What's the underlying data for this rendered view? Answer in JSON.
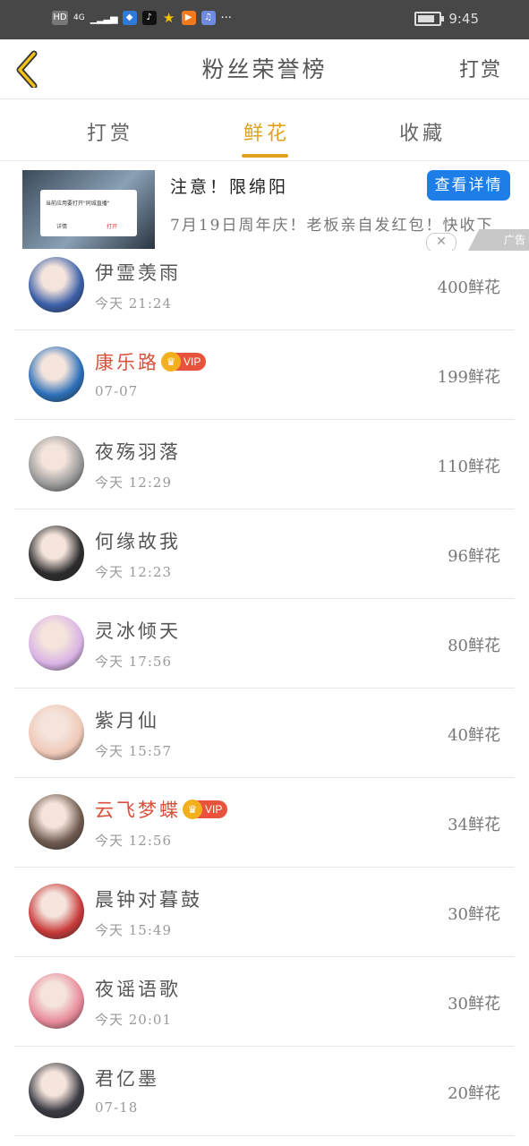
{
  "status_bar": {
    "hd": "HD",
    "network": "4G",
    "time": "9:45",
    "more": "···",
    "icons": [
      "shield-app-icon",
      "tiktok-icon",
      "star-app-icon",
      "video-app-icon",
      "music-app-icon"
    ]
  },
  "header": {
    "title": "粉丝荣誉榜",
    "action": "打赏"
  },
  "tabs": [
    {
      "label": "打赏",
      "active": false
    },
    {
      "label": "鲜花",
      "active": true
    },
    {
      "label": "收藏",
      "active": false
    }
  ],
  "ad": {
    "title": "注意！限绵阳",
    "description": "7月19日周年庆！老板亲自发红包！快收下",
    "button": "查看详情",
    "tag": "广告",
    "dialog_text": "当前应用要打开\"同城直播\"",
    "dialog_left": "详情",
    "dialog_right": "打开"
  },
  "vip_label": "VIP",
  "fans": [
    {
      "name": "伊霊羡雨",
      "time": "今天 21:24",
      "amount": "400鲜花",
      "vip": false,
      "avatar_color": "#3a5ea8"
    },
    {
      "name": "康乐路",
      "time": "07-07",
      "amount": "199鲜花",
      "vip": true,
      "avatar_color": "#2b6fb8"
    },
    {
      "name": "夜殇羽落",
      "time": "今天 12:29",
      "amount": "110鲜花",
      "vip": false,
      "avatar_color": "#9a9a9a"
    },
    {
      "name": "何缘故我",
      "time": "今天 12:23",
      "amount": "96鲜花",
      "vip": false,
      "avatar_color": "#2c2c2c"
    },
    {
      "name": "灵冰倾天",
      "time": "今天 17:56",
      "amount": "80鲜花",
      "vip": false,
      "avatar_color": "#d9b3e6"
    },
    {
      "name": "紫月仙",
      "time": "今天 15:57",
      "amount": "40鲜花",
      "vip": false,
      "avatar_color": "#f0c9b8"
    },
    {
      "name": "云飞梦蝶",
      "time": "今天 12:56",
      "amount": "34鲜花",
      "vip": true,
      "avatar_color": "#6e5a4e"
    },
    {
      "name": "晨钟对暮鼓",
      "time": "今天 15:49",
      "amount": "30鲜花",
      "vip": false,
      "avatar_color": "#c83a3a"
    },
    {
      "name": "夜谣语歌",
      "time": "今天 20:01",
      "amount": "30鲜花",
      "vip": false,
      "avatar_color": "#e88a9a"
    },
    {
      "name": "君亿墨",
      "time": "07-18",
      "amount": "20鲜花",
      "vip": false,
      "avatar_color": "#3a3a42"
    }
  ]
}
